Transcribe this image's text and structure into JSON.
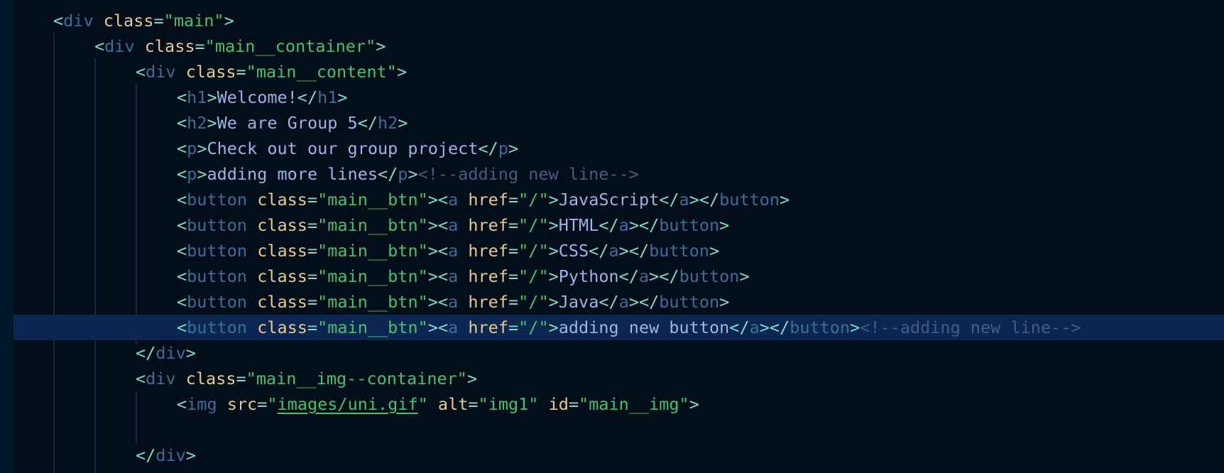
{
  "editor": {
    "language": "html",
    "lines": [
      "<div class=\"main\">",
      "<div class=\"main__container\">",
      "<div class=\"main__content\">",
      "<h1>Welcome!</h1>",
      "<h2>We are Group 5</h2>",
      "<p>Check out our group project</p>",
      "<p>adding more lines</p><!--adding new line-->",
      "<button class=\"main__btn\"><a href=\"/\">JavaScript</a></button>",
      "<button class=\"main__btn\"><a href=\"/\">HTML</a></button>",
      "<button class=\"main__btn\"><a href=\"/\">CSS</a></button>",
      "<button class=\"main__btn\"><a href=\"/\">Python</a></button>",
      "<button class=\"main__btn\"><a href=\"/\">Java</a></button>",
      "<button class=\"main__btn\"><a href=\"/\">adding new button</a></button><!--adding new line-->",
      "</div>",
      "<div class=\"main__img--container\">",
      "<img src=\"images/uni.gif\" alt=\"img1\" id=\"main__img\">",
      "",
      "</div>"
    ],
    "active_line": 13,
    "colors": {
      "background": "#010e1a",
      "active_line": "#0b2650",
      "tag": "#3a6e9c",
      "punctuation": "#7fdbca",
      "attribute": "#e8c98a",
      "string": "#43c46c",
      "text": "#9ab5e6",
      "comment": "#3f5f86"
    }
  }
}
